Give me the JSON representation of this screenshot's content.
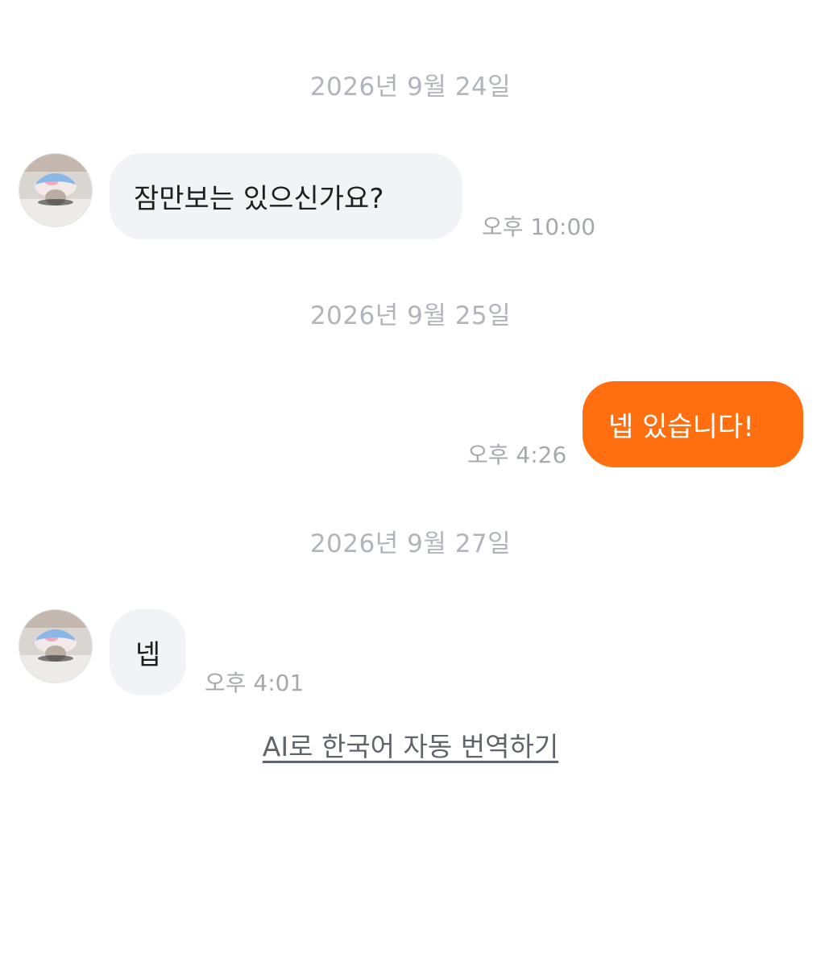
{
  "messages_view": {
    "date_separators": [
      "2026년 9월 24일",
      "2026년 9월 25일",
      "2026년 9월 27일"
    ],
    "messages": [
      {
        "direction": "incoming",
        "text": "잠만보는 있으신가요?",
        "time": "오후 10:00"
      },
      {
        "direction": "outgoing",
        "text": "넵 있습니다!",
        "time": "오후 4:26"
      },
      {
        "direction": "incoming",
        "text": "넵",
        "time": "오후 4:01"
      }
    ],
    "translate_link": "AI로 한국어 자동 번역하기"
  },
  "colors": {
    "outgoing_bubble": "#ff6f0f",
    "incoming_bubble": "#f2f3f6",
    "muted_text": "#b1b5bb",
    "avatar_cap": "#8ab6e8"
  },
  "icons": {
    "sender_avatar": "avatar-photo-rabbit-in-blue-cap"
  }
}
